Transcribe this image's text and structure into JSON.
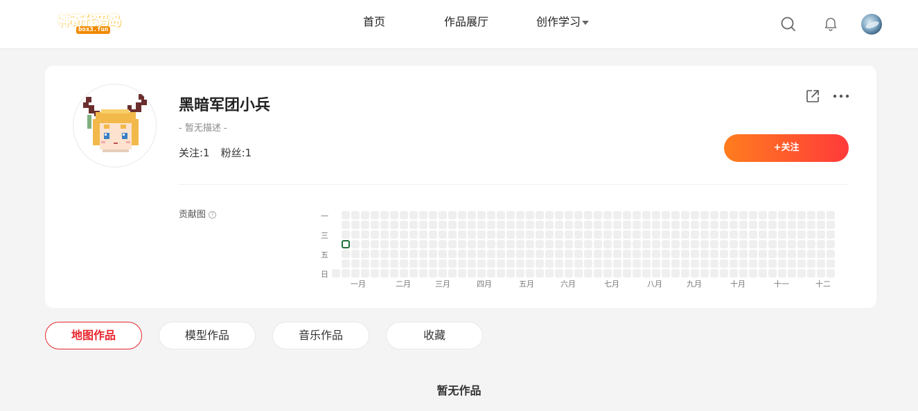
{
  "header": {
    "logo": {
      "text": "神奇代码岛",
      "sub": "box3.fun"
    },
    "nav": [
      {
        "label": "首页"
      },
      {
        "label": "作品展厅"
      },
      {
        "label": "创作学习"
      }
    ],
    "icons": [
      "search-icon",
      "bell-icon",
      "user-avatar"
    ]
  },
  "profile": {
    "name": "黑暗军团小兵",
    "description": "- 暂无描述 -",
    "following": "关注:1",
    "followers": "粉丝:1",
    "follow_button": "+关注",
    "icons": [
      "share-icon",
      "more-icon"
    ]
  },
  "contribution": {
    "title": "贡献图",
    "day_labels": [
      "一",
      "三",
      "五",
      "日"
    ],
    "months": [
      "一月",
      "二月",
      "三月",
      "四月",
      "五月",
      "六月",
      "七月",
      "八月",
      "九月",
      "十月",
      "十一",
      "十二"
    ],
    "weeks": 53,
    "days": 7,
    "active_cells": [
      {
        "week": 1,
        "day": 3
      }
    ],
    "active_color": "#216e39",
    "empty_color": "#efefef"
  },
  "tabs": [
    {
      "label": "地图作品",
      "active": true
    },
    {
      "label": "模型作品",
      "active": false
    },
    {
      "label": "音乐作品",
      "active": false
    },
    {
      "label": "收藏",
      "active": false
    }
  ],
  "empty_message": "暂无作品",
  "colors": {
    "accent": "#e8242b",
    "follow_gradient_start": "#ff7d1e",
    "follow_gradient_end": "#ff3a3a"
  }
}
